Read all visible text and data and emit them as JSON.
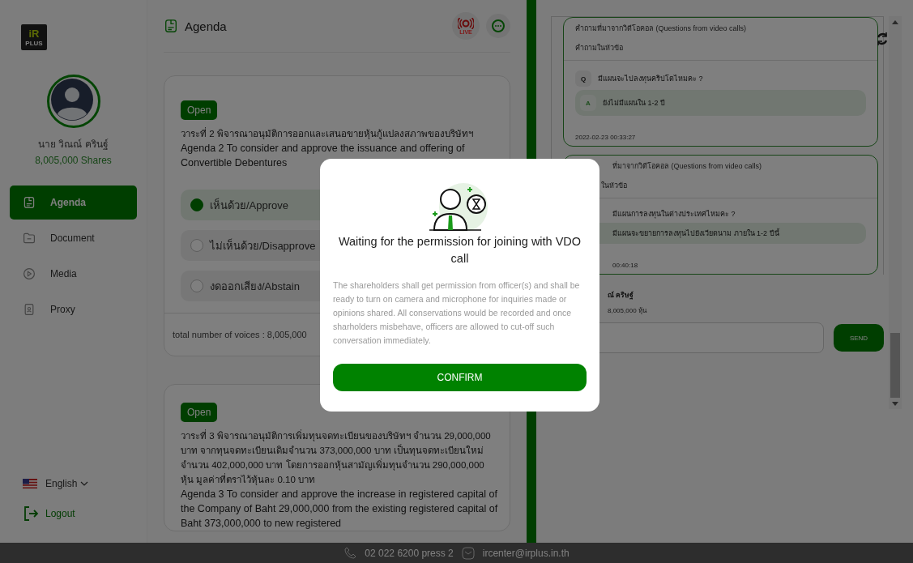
{
  "logo": {
    "mark": "iR",
    "caption": "PLUS"
  },
  "user": {
    "name": "นาย วิณณ์ ครินฐ์",
    "shares": "8,005,000 Shares"
  },
  "nav": [
    {
      "label": "Agenda",
      "selected": true
    },
    {
      "label": "Document",
      "selected": false
    },
    {
      "label": "Media",
      "selected": false
    },
    {
      "label": "Proxy",
      "selected": false
    }
  ],
  "language": {
    "label": "English"
  },
  "logout": {
    "label": "Logout"
  },
  "header": {
    "title": "Agenda",
    "live_label": "LIVE"
  },
  "agendas": [
    {
      "status": "Open",
      "title_th": "วาระที่ 2 พิจารณาอนุมัติการออกและเสนอขายหุ้นกู้แปลงสภาพของบริษัทฯ",
      "title_en": "Agenda 2 To consider and approve the issuance and offering of Convertible Debentures",
      "options": [
        {
          "label": "เห็นด้วย/Approve",
          "selected": true
        },
        {
          "label": "ไม่เห็นด้วย/Disapprove",
          "selected": false
        },
        {
          "label": "งดออกเสียง/Abstain",
          "selected": false
        }
      ],
      "total": "total number of voices : 8,005,000"
    },
    {
      "status": "Open",
      "title_th": "วาระที่ 3 พิจารณาอนุมัติการเพิ่มทุนจดทะเบียนของบริษัทฯ จำนวน 29,000,000 บาท จากทุนจดทะเบียนเดิมจำนวน 373,000,000 บาท เป็นทุนจดทะเบียนใหม่จำนวน 402,000,000 บาท โดยการออกหุ้นสามัญเพิ่มทุนจำนวน 290,000,000 หุ้น มูลค่าที่ตราไว้หุ้นละ 0.10 บาท",
      "title_en": "Agenda 3 To consider and approve the increase in registered capital of the Company of Baht 29,000,000 from the existing registered capital of Baht 373,000,000 to new registered"
    }
  ],
  "qa": {
    "threads": [
      {
        "title": "คำถามที่มาจากวิดีโอคอล (Questions from video calls)",
        "subtitle": "คำถามในหัวข้อ",
        "q_mark": "Q",
        "question": "มีแผนจะไปลงทุนคริปโตไหมคะ ?",
        "a_mark": "A",
        "answer": "ยังไม่มีแผนใน 1-2 ปี",
        "time": "2022-02-23 00:33:27"
      },
      {
        "title": "ที่มาจากวิดีโอคอล (Questions from video calls)",
        "subtitle": "ในหัวข้อ",
        "question": "มีแผนการลงทุนในต่างประเทศไหมคะ ?",
        "answer": "มีแผนจะขยายการลงทุนไปยังเวียดนาม ภายใน 1-2 ปีนี้",
        "time": "00:40:18"
      }
    ],
    "author": "ณ์ คริษฐ์",
    "author_shares": "8,005,000 หุ้น",
    "send": "SEND"
  },
  "modal": {
    "title": "Waiting for the permission for joining with VDO call",
    "body": "The shareholders shall get permission from officer(s) and shall be ready to turn on camera and microphone for inquiries made or opinions shared. All conservations would be recorded and once sharholders misbehave, officers are allowed to cut-off such conversation immediately.",
    "confirm": "CONFIRM"
  },
  "footer": {
    "phone": "02 022 6200 press 2",
    "email": "ircenter@irplus.in.th"
  }
}
